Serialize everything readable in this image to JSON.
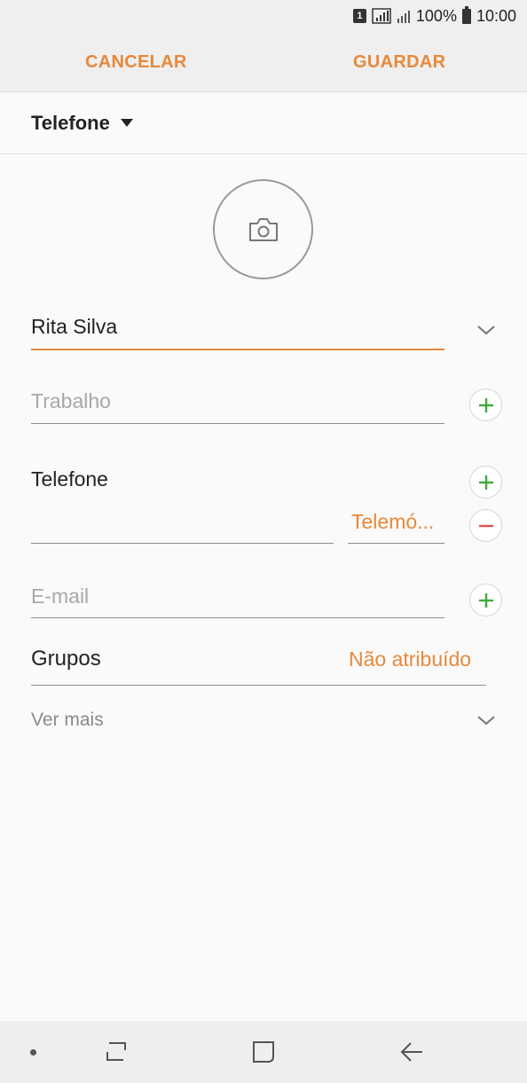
{
  "status_bar": {
    "sim": "1",
    "battery": "100%",
    "time": "10:00"
  },
  "action_bar": {
    "cancel_label": "CANCELAR",
    "save_label": "GUARDAR"
  },
  "account": {
    "label": "Telefone"
  },
  "form": {
    "name_value": "Rita Silva",
    "company_placeholder": "Trabalho",
    "phone_label": "Telefone",
    "phone_value": "",
    "phone_type": "Telemó...",
    "email_placeholder": "E-mail",
    "groups_label": "Grupos",
    "groups_value": "Não atribuído",
    "see_more_label": "Ver mais"
  },
  "colors": {
    "accent": "#e8883a",
    "add": "#3ea83a",
    "remove": "#e05353"
  },
  "icons": {
    "photo": "camera-icon",
    "expand": "chevron-down-icon",
    "add": "plus-icon",
    "remove": "minus-icon",
    "nav_recents": "recents-icon",
    "nav_home": "home-icon",
    "nav_back": "back-icon"
  }
}
